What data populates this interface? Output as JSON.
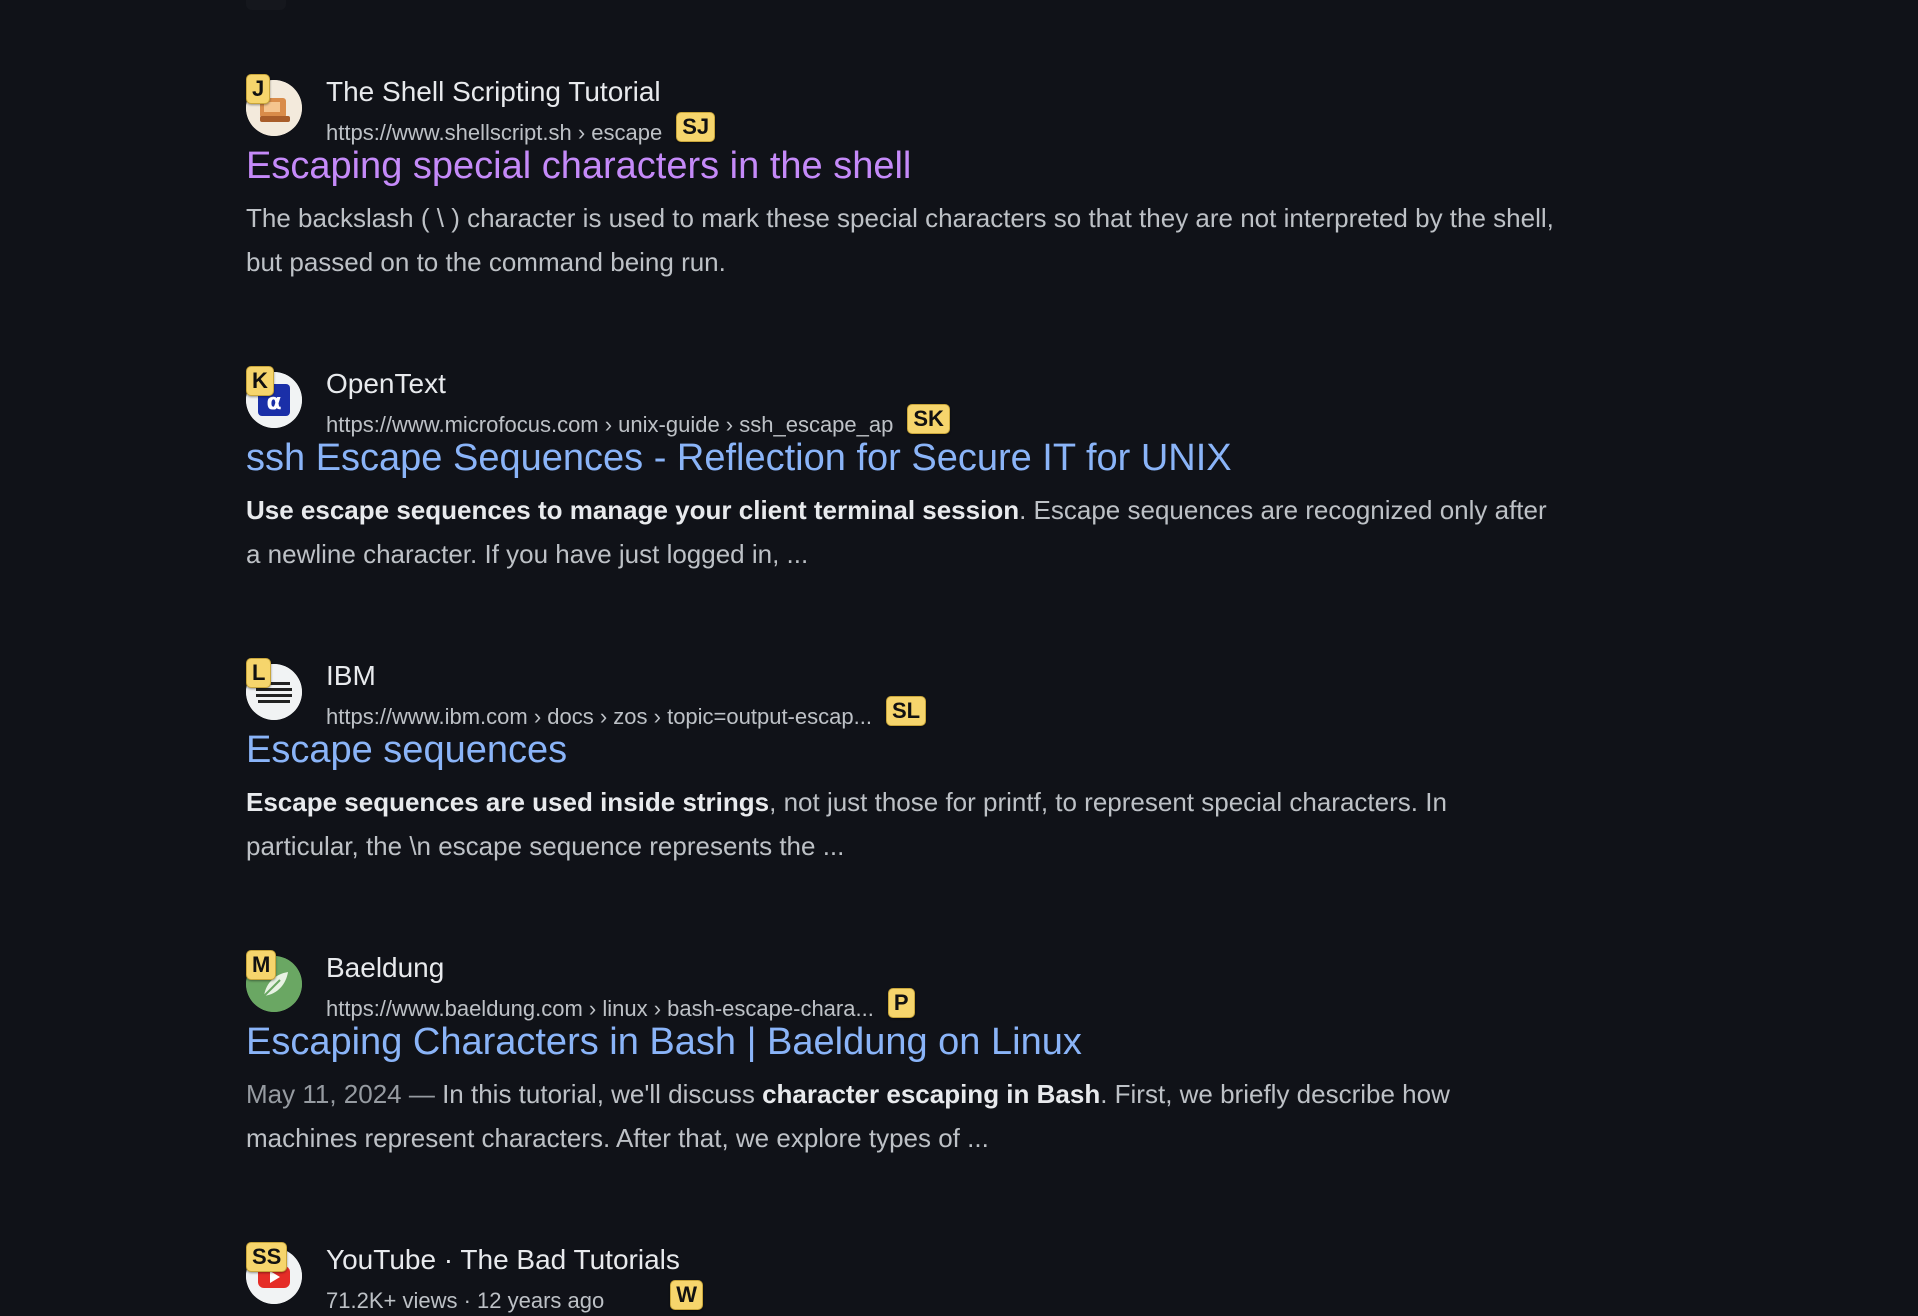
{
  "results": [
    {
      "hint_favicon": "J",
      "hint_url": "SJ",
      "site": "The Shell Scripting Tutorial",
      "url": "https://www.shellscript.sh › escape",
      "title": "Escaping special characters in the shell",
      "visited": true,
      "snippet_bold": "",
      "snippet_rest": "The backslash ( \\ ) character is used to mark these special characters so that they are not interpreted by the shell, but passed on to the command being run.",
      "date": "",
      "icon": "shell-scripting-favicon-icon"
    },
    {
      "hint_favicon": "K",
      "hint_url": "SK",
      "site": "OpenText",
      "url": "https://www.microfocus.com › unix-guide › ssh_escape_ap",
      "title": "ssh Escape Sequences - Reflection for Secure IT for UNIX",
      "visited": false,
      "snippet_bold": "Use escape sequences to manage your client terminal session",
      "snippet_rest": ". Escape sequences are recognized only after a newline character. If you have just logged in, ...",
      "date": "",
      "icon": "opentext-favicon-icon"
    },
    {
      "hint_favicon": "L",
      "hint_url": "SL",
      "site": "IBM",
      "url": "https://www.ibm.com › docs › zos › topic=output-escap...",
      "title": "Escape sequences",
      "visited": false,
      "snippet_bold": "Escape sequences are used inside strings",
      "snippet_rest": ", not just those for printf, to represent special characters. In particular, the \\n escape sequence represents the ...",
      "date": "",
      "icon": "ibm-favicon-icon"
    },
    {
      "hint_favicon": "M",
      "hint_url": "P",
      "site": "Baeldung",
      "url": "https://www.baeldung.com › linux › bash-escape-chara...",
      "title": "Escaping Characters in Bash | Baeldung on Linux",
      "visited": false,
      "snippet_pre": "In this tutorial, we'll discuss ",
      "snippet_bold": "character escaping in Bash",
      "snippet_rest": ". First, we briefly describe how machines represent characters. After that, we explore types of ...",
      "date": "May 11, 2024 — ",
      "icon": "baeldung-favicon-icon"
    },
    {
      "hint_favicon": "SS",
      "hint_url": "W",
      "site": "YouTube · The Bad Tutorials",
      "url": "71.2K+ views · 12 years ago",
      "icon": "youtube-favicon-icon"
    }
  ]
}
